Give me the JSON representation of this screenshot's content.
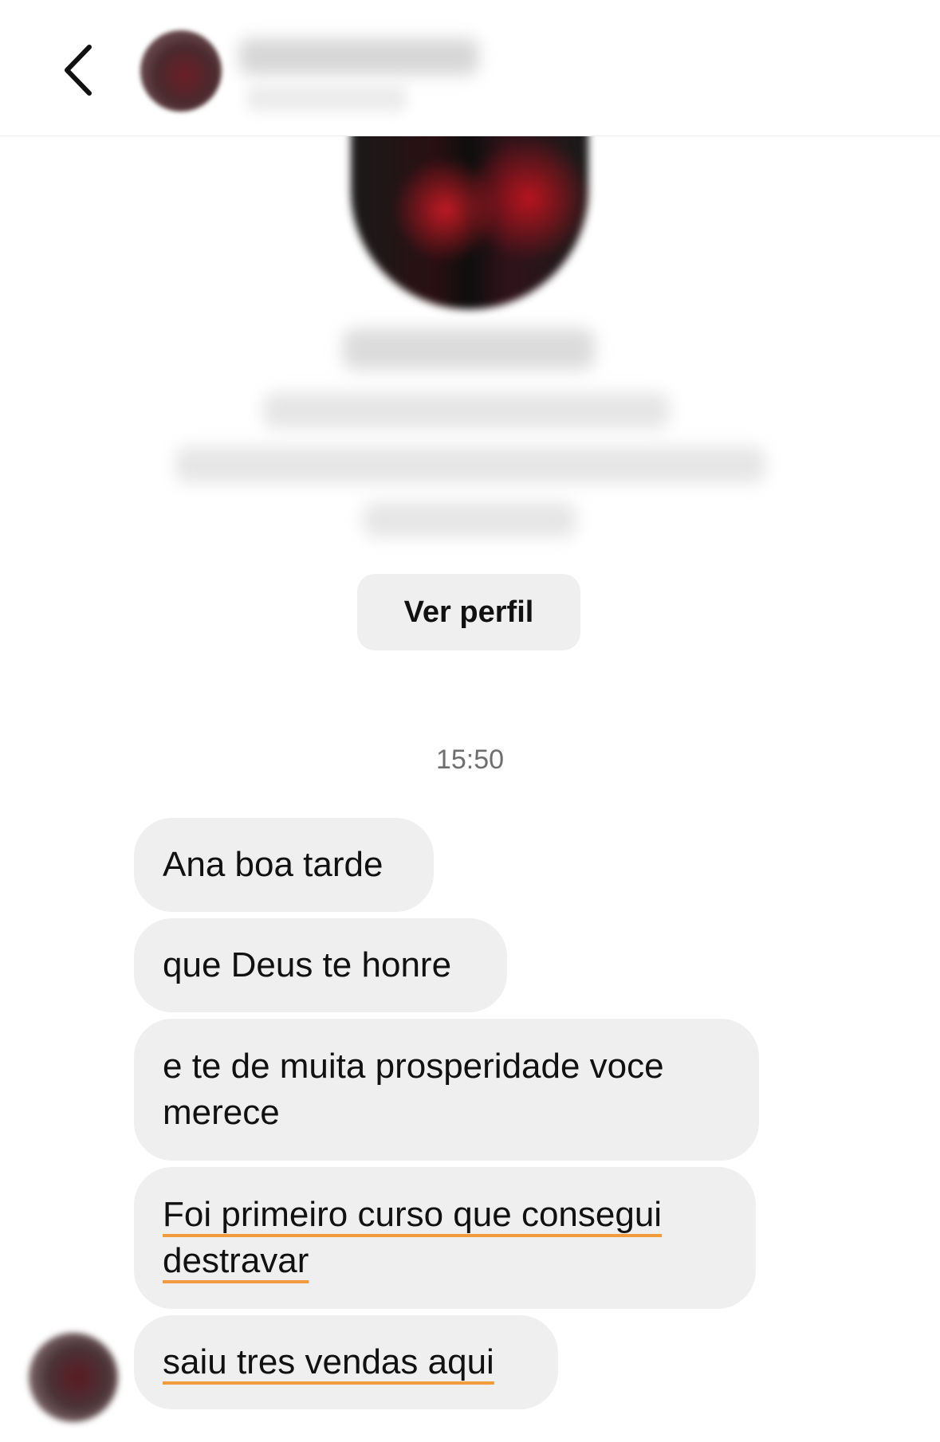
{
  "header": {
    "back_icon": "chevron-left-icon",
    "contact_name": "",
    "contact_subtitle": ""
  },
  "profile_card": {
    "name": "",
    "bio_lines": [
      "",
      "",
      ""
    ],
    "view_profile_label": "Ver perfil"
  },
  "conversation": {
    "timestamp": "15:50",
    "messages": [
      {
        "text": "Ana boa tarde"
      },
      {
        "text": "que Deus te honre"
      },
      {
        "text": "e te de muita prosperidade voce merece"
      },
      {
        "text": "Foi primeiro curso que consegui destravar",
        "underlined": true
      },
      {
        "text": "saiu tres vendas aqui",
        "underlined": true
      }
    ]
  },
  "colors": {
    "bubble_background": "#efefef",
    "spellcheck_underline": "#f19a3e",
    "timestamp_text": "#6f6f6f"
  }
}
